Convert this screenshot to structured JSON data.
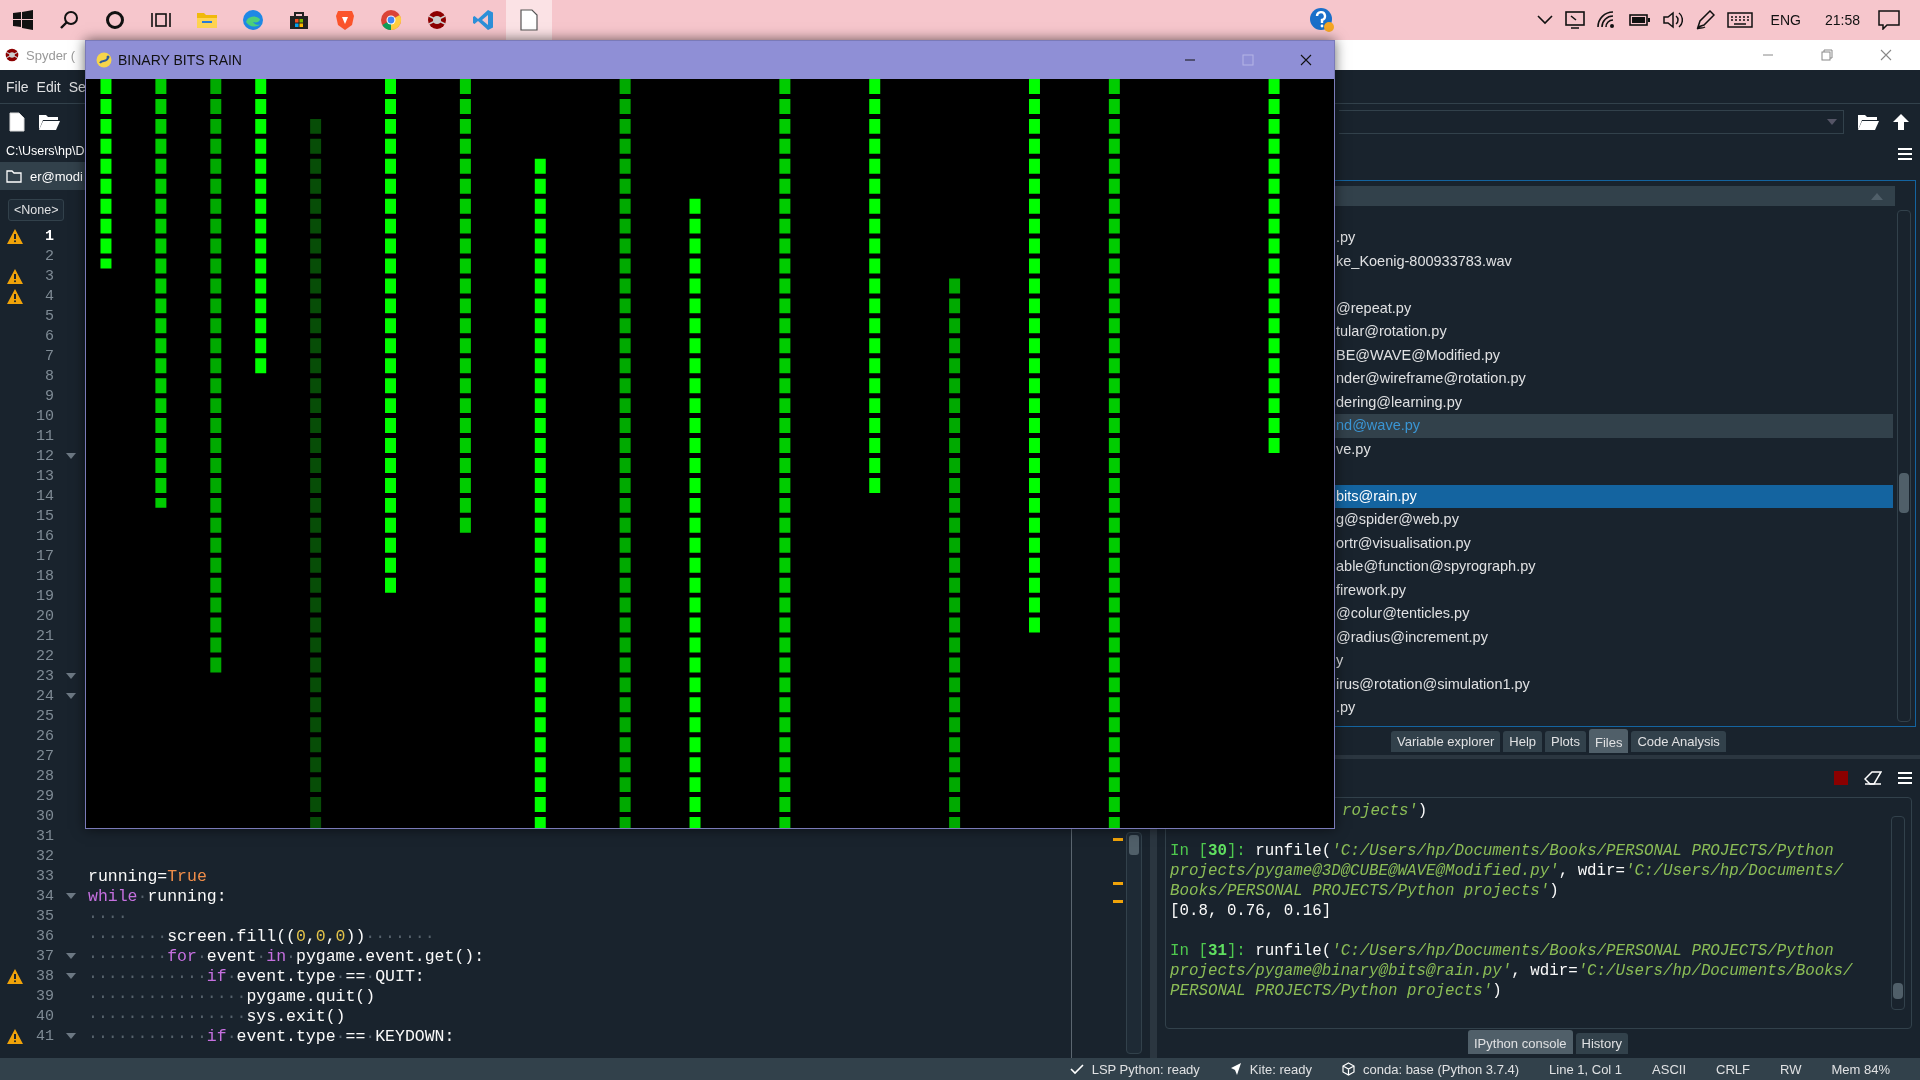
{
  "taskbar": {
    "buttons": [
      {
        "kind": "start"
      },
      {
        "kind": "search"
      },
      {
        "kind": "cortana"
      },
      {
        "kind": "taskview"
      }
    ],
    "apps": [
      {
        "kind": "folder",
        "selected": false
      },
      {
        "kind": "edge",
        "selected": false
      },
      {
        "kind": "store",
        "selected": false
      },
      {
        "kind": "brave",
        "selected": false
      },
      {
        "kind": "chrome",
        "selected": false
      },
      {
        "kind": "spider",
        "selected": false
      },
      {
        "kind": "vscode",
        "selected": false
      },
      {
        "kind": "blank",
        "selected": true
      }
    ],
    "tray": {
      "language": "ENG",
      "time": "21:58"
    }
  },
  "spyder": {
    "title": "Spyder (",
    "menu": [
      "File",
      "Edit",
      "Se"
    ],
    "working_dir": "C:\\Users\\hp\\D",
    "editor_tab": "er@modi",
    "outline_combo": "<None>",
    "editor": {
      "lines": [
        {
          "number": "1",
          "current": true,
          "warning": true,
          "fold": false
        },
        {
          "number": "2",
          "current": false,
          "warning": false,
          "fold": false
        },
        {
          "number": "3",
          "current": false,
          "warning": true,
          "fold": false
        },
        {
          "number": "4",
          "current": false,
          "warning": true,
          "fold": false
        },
        {
          "number": "5",
          "current": false,
          "warning": false,
          "fold": false
        },
        {
          "number": "6",
          "current": false,
          "warning": false,
          "fold": false
        },
        {
          "number": "7",
          "current": false,
          "warning": false,
          "fold": false
        },
        {
          "number": "8",
          "current": false,
          "warning": false,
          "fold": false
        },
        {
          "number": "9",
          "current": false,
          "warning": false,
          "fold": false
        },
        {
          "number": "10",
          "current": false,
          "warning": false,
          "fold": false
        },
        {
          "number": "11",
          "current": false,
          "warning": false,
          "fold": false
        },
        {
          "number": "12",
          "current": false,
          "warning": false,
          "fold": true
        },
        {
          "number": "13",
          "current": false,
          "warning": false,
          "fold": false
        },
        {
          "number": "14",
          "current": false,
          "warning": false,
          "fold": false
        },
        {
          "number": "15",
          "current": false,
          "warning": false,
          "fold": false
        },
        {
          "number": "16",
          "current": false,
          "warning": false,
          "fold": false
        },
        {
          "number": "17",
          "current": false,
          "warning": false,
          "fold": false
        },
        {
          "number": "18",
          "current": false,
          "warning": false,
          "fold": false
        },
        {
          "number": "19",
          "current": false,
          "warning": false,
          "fold": false
        },
        {
          "number": "20",
          "current": false,
          "warning": false,
          "fold": false
        },
        {
          "number": "21",
          "current": false,
          "warning": false,
          "fold": false
        },
        {
          "number": "22",
          "current": false,
          "warning": false,
          "fold": false
        },
        {
          "number": "23",
          "current": false,
          "warning": false,
          "fold": true
        },
        {
          "number": "24",
          "current": false,
          "warning": false,
          "fold": true
        },
        {
          "number": "25",
          "current": false,
          "warning": false,
          "fold": false
        },
        {
          "number": "26",
          "current": false,
          "warning": false,
          "fold": false
        },
        {
          "number": "27",
          "current": false,
          "warning": false,
          "fold": false
        },
        {
          "number": "28",
          "current": false,
          "warning": false,
          "fold": false
        },
        {
          "number": "29",
          "current": false,
          "warning": false,
          "fold": false
        },
        {
          "number": "30",
          "current": false,
          "warning": false,
          "fold": false
        },
        {
          "number": "31",
          "current": false,
          "warning": false,
          "fold": false
        },
        {
          "number": "32",
          "current": false,
          "warning": false,
          "fold": false
        },
        {
          "number": "33",
          "current": false,
          "warning": false,
          "fold": false,
          "tokens": [
            {
              "kind": "plain",
              "text": "running="
            },
            {
              "kind": "const",
              "text": "True"
            }
          ]
        },
        {
          "number": "34",
          "current": false,
          "warning": false,
          "fold": true,
          "tokens": [
            {
              "kind": "kw",
              "text": "while"
            },
            {
              "kind": "ws",
              "text": "·"
            },
            {
              "kind": "plain",
              "text": "running:"
            }
          ]
        },
        {
          "number": "35",
          "current": false,
          "warning": false,
          "fold": false,
          "tokens": [
            {
              "kind": "ws",
              "text": "····"
            }
          ]
        },
        {
          "number": "36",
          "current": false,
          "warning": false,
          "fold": false,
          "tokens": [
            {
              "kind": "ws",
              "text": "········"
            },
            {
              "kind": "plain",
              "text": "screen.fill(("
            },
            {
              "kind": "num",
              "text": "0"
            },
            {
              "kind": "plain",
              "text": ","
            },
            {
              "kind": "num",
              "text": "0"
            },
            {
              "kind": "plain",
              "text": ","
            },
            {
              "kind": "num",
              "text": "0"
            },
            {
              "kind": "plain",
              "text": "))"
            },
            {
              "kind": "ws",
              "text": "·······"
            }
          ]
        },
        {
          "number": "37",
          "current": false,
          "warning": false,
          "fold": true,
          "tokens": [
            {
              "kind": "ws",
              "text": "········"
            },
            {
              "kind": "kw",
              "text": "for"
            },
            {
              "kind": "ws",
              "text": "·"
            },
            {
              "kind": "plain",
              "text": "event"
            },
            {
              "kind": "ws",
              "text": "·"
            },
            {
              "kind": "kw",
              "text": "in"
            },
            {
              "kind": "ws",
              "text": "·"
            },
            {
              "kind": "plain",
              "text": "pygame.event.get():"
            }
          ]
        },
        {
          "number": "38",
          "current": false,
          "warning": true,
          "fold": true,
          "tokens": [
            {
              "kind": "ws",
              "text": "············"
            },
            {
              "kind": "kw",
              "text": "if"
            },
            {
              "kind": "ws",
              "text": "·"
            },
            {
              "kind": "plain",
              "text": "event.type"
            },
            {
              "kind": "ws",
              "text": "·"
            },
            {
              "kind": "plain",
              "text": "=="
            },
            {
              "kind": "ws",
              "text": "·"
            },
            {
              "kind": "plain",
              "text": "QUIT:"
            }
          ]
        },
        {
          "number": "39",
          "current": false,
          "warning": false,
          "fold": false,
          "tokens": [
            {
              "kind": "ws",
              "text": "················"
            },
            {
              "kind": "plain",
              "text": "pygame.quit()"
            }
          ]
        },
        {
          "number": "40",
          "current": false,
          "warning": false,
          "fold": false,
          "tokens": [
            {
              "kind": "ws",
              "text": "················"
            },
            {
              "kind": "plain",
              "text": "sys.exit()"
            }
          ]
        },
        {
          "number": "41",
          "current": false,
          "warning": true,
          "fold": true,
          "tokens": [
            {
              "kind": "ws",
              "text": "············"
            },
            {
              "kind": "kw",
              "text": "if"
            },
            {
              "kind": "ws",
              "text": "·"
            },
            {
              "kind": "plain",
              "text": "event.type"
            },
            {
              "kind": "ws",
              "text": "·"
            },
            {
              "kind": "plain",
              "text": "=="
            },
            {
              "kind": "ws",
              "text": "·"
            },
            {
              "kind": "plain",
              "text": "KEYDOWN:"
            }
          ]
        }
      ]
    },
    "files": {
      "items": [
        {
          "name": ".py",
          "selected": false,
          "hovered": false
        },
        {
          "name": "ke_Koenig-800933783.wav",
          "selected": false,
          "hovered": false
        },
        {
          "name": "@repeat.py",
          "selected": false,
          "hovered": false,
          "gap_before": true
        },
        {
          "name": "tular@rotation.py",
          "selected": false,
          "hovered": false
        },
        {
          "name": "BE@WAVE@Modified.py",
          "selected": false,
          "hovered": false
        },
        {
          "name": "nder@wireframe@rotation.py",
          "selected": false,
          "hovered": false
        },
        {
          "name": "dering@learning.py",
          "selected": false,
          "hovered": false
        },
        {
          "name": "nd@wave.py",
          "selected": false,
          "hovered": true
        },
        {
          "name": "ve.py",
          "selected": false,
          "hovered": false
        },
        {
          "name": "bits@rain.py",
          "selected": true,
          "hovered": false,
          "gap_before": true
        },
        {
          "name": "g@spider@web.py",
          "selected": false,
          "hovered": false
        },
        {
          "name": "ortr@visualisation.py",
          "selected": false,
          "hovered": false
        },
        {
          "name": "able@function@spyrograph.py",
          "selected": false,
          "hovered": false
        },
        {
          "name": "firework.py",
          "selected": false,
          "hovered": false
        },
        {
          "name": "@colur@tenticles.py",
          "selected": false,
          "hovered": false
        },
        {
          "name": "@radius@increment.py",
          "selected": false,
          "hovered": false
        },
        {
          "name": "y",
          "selected": false,
          "hovered": false
        },
        {
          "name": "irus@rotation@simulation1.py",
          "selected": false,
          "hovered": false
        },
        {
          "name": ".py",
          "selected": false,
          "hovered": false
        }
      ],
      "tabs": [
        {
          "label": "Variable explorer",
          "selected": false
        },
        {
          "label": "Help",
          "selected": false
        },
        {
          "label": "Plots",
          "selected": false
        },
        {
          "label": "Files",
          "selected": true
        },
        {
          "label": "Code Analysis",
          "selected": false
        }
      ]
    },
    "console": {
      "lines": [
        {
          "cut": true,
          "tokens": [
            {
              "kind": "string",
              "text": "rojects'"
            },
            {
              "kind": "plain",
              "text": ")"
            }
          ]
        },
        {
          "gap_before": true,
          "tokens": [
            {
              "kind": "prompt",
              "text": "In ["
            },
            {
              "kind": "prompt_num",
              "text": "30"
            },
            {
              "kind": "prompt",
              "text": "]: "
            },
            {
              "kind": "plain",
              "text": "runfile("
            },
            {
              "kind": "string",
              "text": "'C:/Users/hp/Documents/Books/PERSONAL PROJECTS/Python"
            }
          ]
        },
        {
          "tokens": [
            {
              "kind": "string",
              "text": "projects/pygame@3D@CUBE@WAVE@Modified.py'"
            },
            {
              "kind": "plain",
              "text": ", wdir="
            },
            {
              "kind": "string",
              "text": "'C:/Users/hp/Documents/"
            }
          ]
        },
        {
          "tokens": [
            {
              "kind": "string",
              "text": "Books/PERSONAL PROJECTS/Python projects'"
            },
            {
              "kind": "plain",
              "text": ")"
            }
          ]
        },
        {
          "tokens": [
            {
              "kind": "plain",
              "text": "[0.8, 0.76, 0.16]"
            }
          ]
        },
        {
          "gap_before": true,
          "tokens": [
            {
              "kind": "prompt",
              "text": "In ["
            },
            {
              "kind": "prompt_num",
              "text": "31"
            },
            {
              "kind": "prompt",
              "text": "]: "
            },
            {
              "kind": "plain",
              "text": "runfile("
            },
            {
              "kind": "string",
              "text": "'C:/Users/hp/Documents/Books/PERSONAL PROJECTS/Python"
            }
          ]
        },
        {
          "tokens": [
            {
              "kind": "string",
              "text": "projects/pygame@binary@bits@rain.py'"
            },
            {
              "kind": "plain",
              "text": ", wdir="
            },
            {
              "kind": "string",
              "text": "'C:/Users/hp/Documents/Books/"
            }
          ]
        },
        {
          "tokens": [
            {
              "kind": "string",
              "text": "PERSONAL PROJECTS/Python projects'"
            },
            {
              "kind": "plain",
              "text": ")"
            }
          ]
        }
      ],
      "tabs": [
        {
          "label": "IPython console",
          "selected": true
        },
        {
          "label": "History",
          "selected": false
        }
      ]
    },
    "status": [
      {
        "kind": "lsp",
        "text": "LSP Python: ready"
      },
      {
        "kind": "kite",
        "text": "Kite: ready"
      },
      {
        "kind": "conda",
        "text": "conda: base (Python 3.7.4)"
      },
      {
        "kind": "plain",
        "text": "Line 1, Col 1"
      },
      {
        "kind": "plain",
        "text": "ASCII"
      },
      {
        "kind": "plain",
        "text": "CRLF"
      },
      {
        "kind": "plain",
        "text": "RW"
      },
      {
        "kind": "plain",
        "text": "Mem 84%"
      }
    ]
  },
  "game_window": {
    "title": "BINARY BITS RAIN"
  }
}
